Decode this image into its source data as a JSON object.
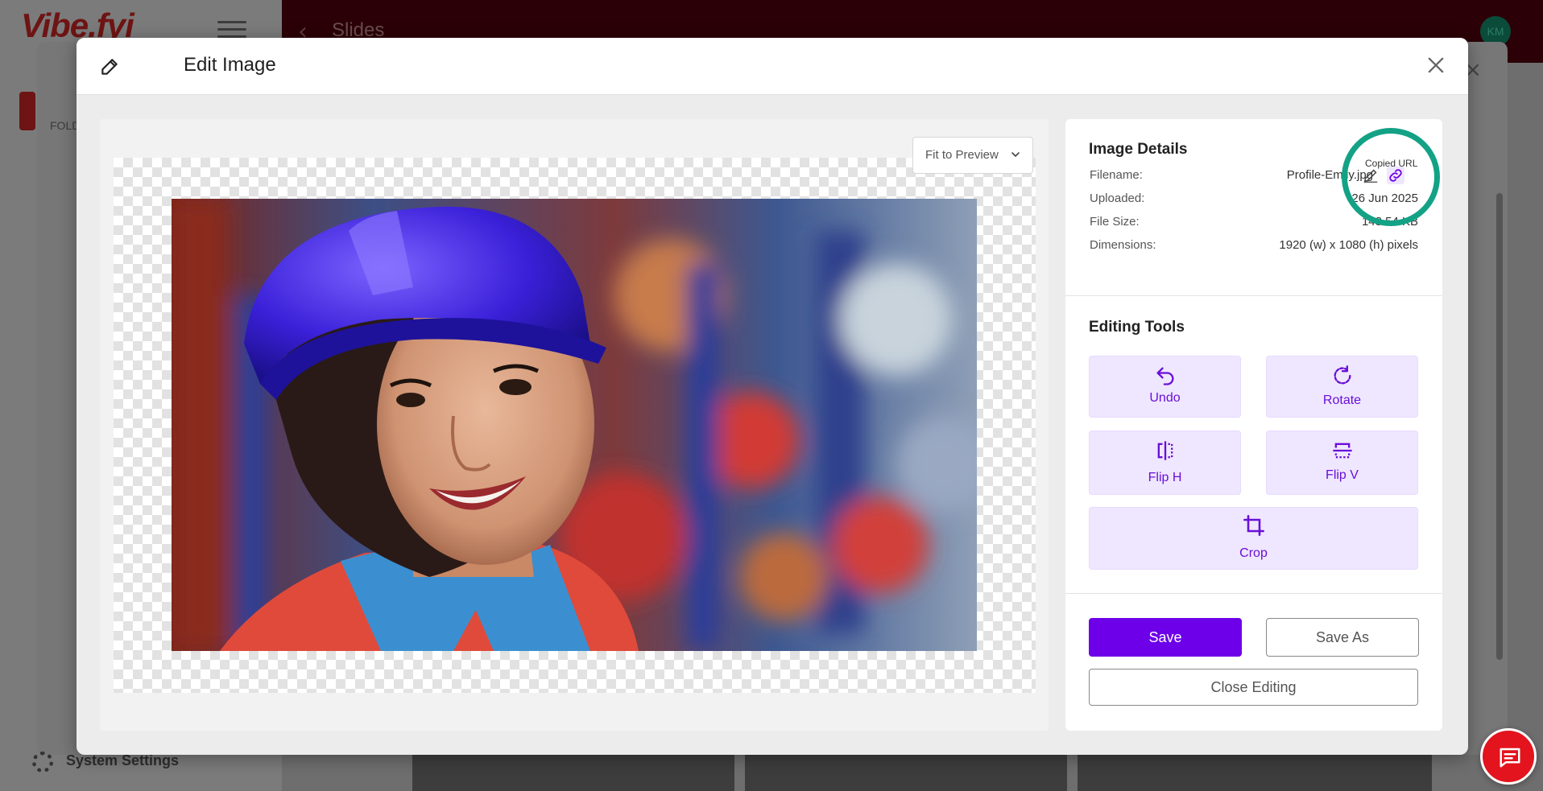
{
  "background": {
    "logo_text": "Vibe.fyi",
    "header_title": "Slides",
    "avatar_initials": "KM",
    "folder_label": "FOLD",
    "system_settings": "System Settings"
  },
  "modal": {
    "title": "Edit Image",
    "close_label": "×"
  },
  "preview": {
    "fit_option": "Fit to Preview",
    "image_alt": "Smiling woman wearing a blue hard hat"
  },
  "details": {
    "title": "Image Details",
    "tooltip": "Copied URL",
    "rows": [
      {
        "label": "Filename:",
        "value": "Profile-Emily.jpg"
      },
      {
        "label": "Uploaded:",
        "value": "26 Jun 2025"
      },
      {
        "label": "File Size:",
        "value": "143.54 KB"
      },
      {
        "label": "Dimensions:",
        "value": "1920 (w) x 1080 (h) pixels"
      }
    ]
  },
  "tools": {
    "title": "Editing Tools",
    "undo": "Undo",
    "rotate": "Rotate",
    "flip_h": "Flip H",
    "flip_v": "Flip V",
    "crop": "Crop"
  },
  "actions": {
    "save": "Save",
    "save_as": "Save As",
    "close_editing": "Close Editing"
  },
  "colors": {
    "accent": "#6d00e8",
    "tool_bg": "#efe7ff",
    "annotation": "#13a286",
    "chat": "#e3141d"
  }
}
